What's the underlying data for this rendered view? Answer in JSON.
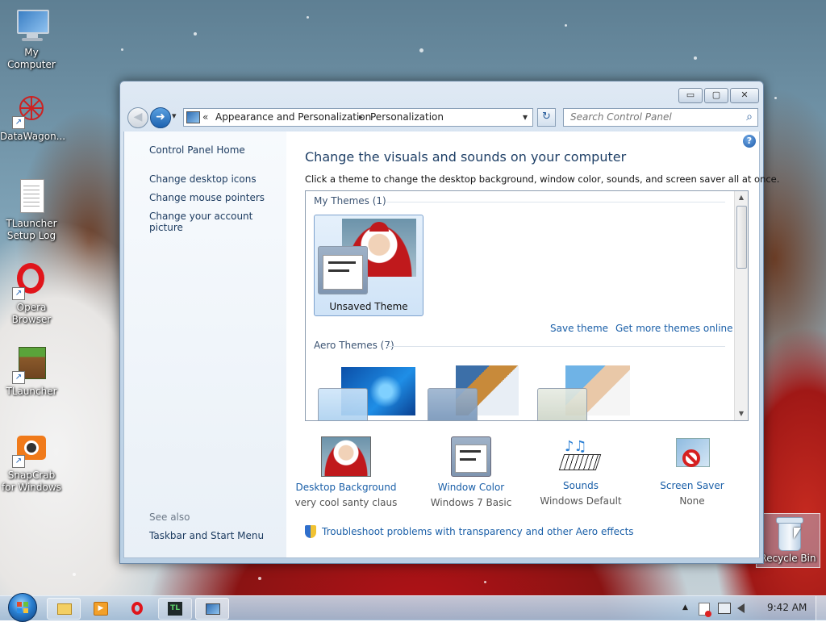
{
  "desktop": {
    "icons": [
      {
        "label": "My Computer",
        "icon": "monitor-icon"
      },
      {
        "label": "DataWagon...",
        "icon": "network-icon"
      },
      {
        "label": "TLauncher Setup Log",
        "icon": "document-icon"
      },
      {
        "label": "Opera Browser",
        "icon": "opera-icon"
      },
      {
        "label": "TLauncher",
        "icon": "grass-block-icon"
      },
      {
        "label": "SnapCrab for Windows",
        "icon": "camera-icon"
      },
      {
        "label": "Recycle Bin",
        "icon": "recycle-bin-icon"
      }
    ]
  },
  "window": {
    "caption_buttons": {
      "minimize": "▭",
      "maximize": "▢",
      "close": "✕"
    },
    "nav": {
      "back": "◀",
      "forward": "➜",
      "history": "▾",
      "breadcrumb_prefix": "«",
      "breadcrumb": [
        "Appearance and Personalization",
        "Personalization"
      ],
      "separator": "▸",
      "dropdown": "▾",
      "refresh": "↻",
      "search_placeholder": "Search Control Panel",
      "search_icon": "⌕"
    },
    "left_pane": {
      "home": "Control Panel Home",
      "links": [
        "Change desktop icons",
        "Change mouse pointers",
        "Change your account picture"
      ],
      "see_also_label": "See also",
      "see_also": [
        "Taskbar and Start Menu"
      ]
    },
    "main": {
      "help": "?",
      "title": "Change the visuals and sounds on your computer",
      "description": "Click a theme to change the desktop background, window color, sounds, and screen saver all at once.",
      "my_themes_title": "My Themes (1)",
      "selected_theme": "Unsaved Theme",
      "save_theme": "Save theme",
      "get_more": "Get more themes online",
      "aero_title": "Aero Themes (7)",
      "scroll_up": "▲",
      "scroll_down": "▼",
      "bottom": [
        {
          "label": "Desktop Background",
          "value": "very cool santy claus"
        },
        {
          "label": "Window Color",
          "value": "Windows 7 Basic"
        },
        {
          "label": "Sounds",
          "value": "Windows Default"
        },
        {
          "label": "Screen Saver",
          "value": "None"
        }
      ],
      "troubleshoot": "Troubleshoot problems with transparency and other Aero effects"
    }
  },
  "taskbar": {
    "start": "start-orb-icon",
    "apps": [
      "file-explorer-icon",
      "media-player-icon",
      "opera-icon",
      "tlauncher-icon",
      "control-panel-icon"
    ],
    "tl_text": "TL",
    "tray_expand": "▲",
    "clock": "9:42 AM"
  },
  "colors": {
    "link": "#1a5fa8",
    "title": "#1e3f66",
    "accent": "#3b7fc4"
  }
}
